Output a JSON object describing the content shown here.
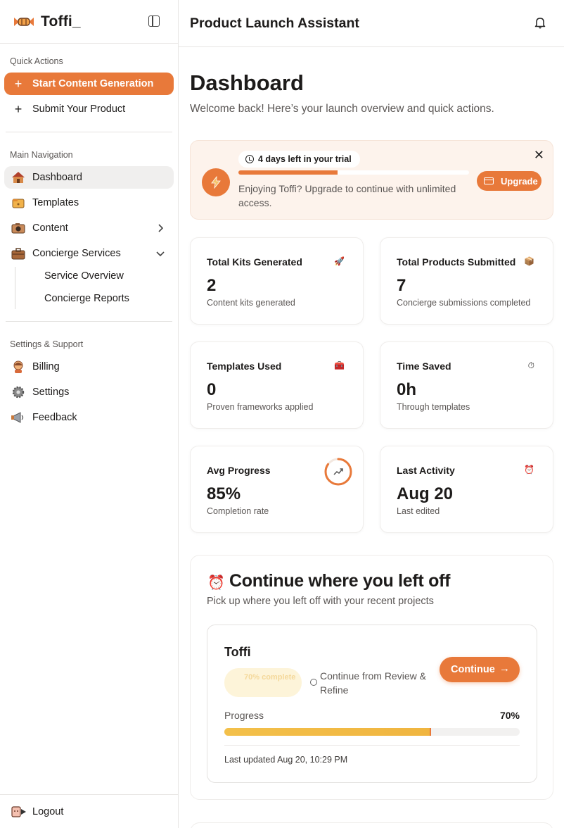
{
  "app": {
    "name": "Toffi_"
  },
  "sidebar": {
    "quick_actions_label": "Quick Actions",
    "quick_actions": [
      {
        "label": "Start Content Generation",
        "icon": "plus-icon"
      },
      {
        "label": "Submit Your Product",
        "icon": "plus-icon"
      }
    ],
    "main_nav_label": "Main Navigation",
    "main_nav": [
      {
        "label": "Dashboard",
        "icon": "house-icon"
      },
      {
        "label": "Templates",
        "icon": "template-icon"
      },
      {
        "label": "Content",
        "icon": "camera-icon"
      },
      {
        "label": "Concierge Services",
        "icon": "briefcase-icon"
      }
    ],
    "concierge_sub": [
      {
        "label": "Service Overview"
      },
      {
        "label": "Concierge Reports"
      }
    ],
    "settings_label": "Settings & Support",
    "settings": [
      {
        "label": "Billing",
        "icon": "person-icon"
      },
      {
        "label": "Settings",
        "icon": "gear-icon"
      },
      {
        "label": "Feedback",
        "icon": "megaphone-icon"
      }
    ],
    "logout_label": "Logout"
  },
  "header": {
    "title": "Product Launch Assistant"
  },
  "main": {
    "title": "Dashboard",
    "subtitle": "Welcome back! Here’s your launch overview and quick actions.",
    "trial": {
      "pill": "4 days left in your trial",
      "progress": 0.43,
      "text": "Enjoying Toffi? Upgrade to continue with unlimited access.",
      "upgrade_label": "Upgrade"
    },
    "stats": [
      {
        "title": "Total Kits Generated",
        "value": "2",
        "sub": "Content kits generated",
        "icon": "rocket-icon",
        "glyph": "🚀"
      },
      {
        "title": "Total Products Submitted",
        "value": "7",
        "sub": "Concierge submissions completed",
        "icon": "package-icon",
        "glyph": "📦"
      },
      {
        "title": "Templates Used",
        "value": "0",
        "sub": "Proven frameworks applied",
        "icon": "toolbox-icon",
        "glyph": "🧰"
      },
      {
        "title": "Time Saved",
        "value": "0h",
        "sub": "Through templates",
        "icon": "stopwatch-icon",
        "glyph": "⏱"
      },
      {
        "title": "Avg Progress",
        "value": "85%",
        "sub": "Completion rate",
        "icon": "trend-up-icon",
        "progress": 0.85
      },
      {
        "title": "Last Activity",
        "value": "Aug 20",
        "sub": "Last edited",
        "icon": "alarm-clock-icon",
        "glyph": "⏰"
      }
    ],
    "continue": {
      "title": "Continue where you left off",
      "subtitle": "Pick up where you left off with your recent projects",
      "project": {
        "name": "Toffi",
        "badge": "70% complete",
        "step": "Continue from Review & Refine",
        "button": "Continue",
        "progress_label": "Progress",
        "progress_value": "70%",
        "progress": 0.7,
        "updated": "Last updated Aug 20, 10:29 PM"
      }
    }
  },
  "colors": {
    "accent": "#e8793a",
    "trial_bg": "#fdf3ec",
    "progress_yellow": "#f3c04a",
    "active_nav_bg": "#f0efee"
  }
}
